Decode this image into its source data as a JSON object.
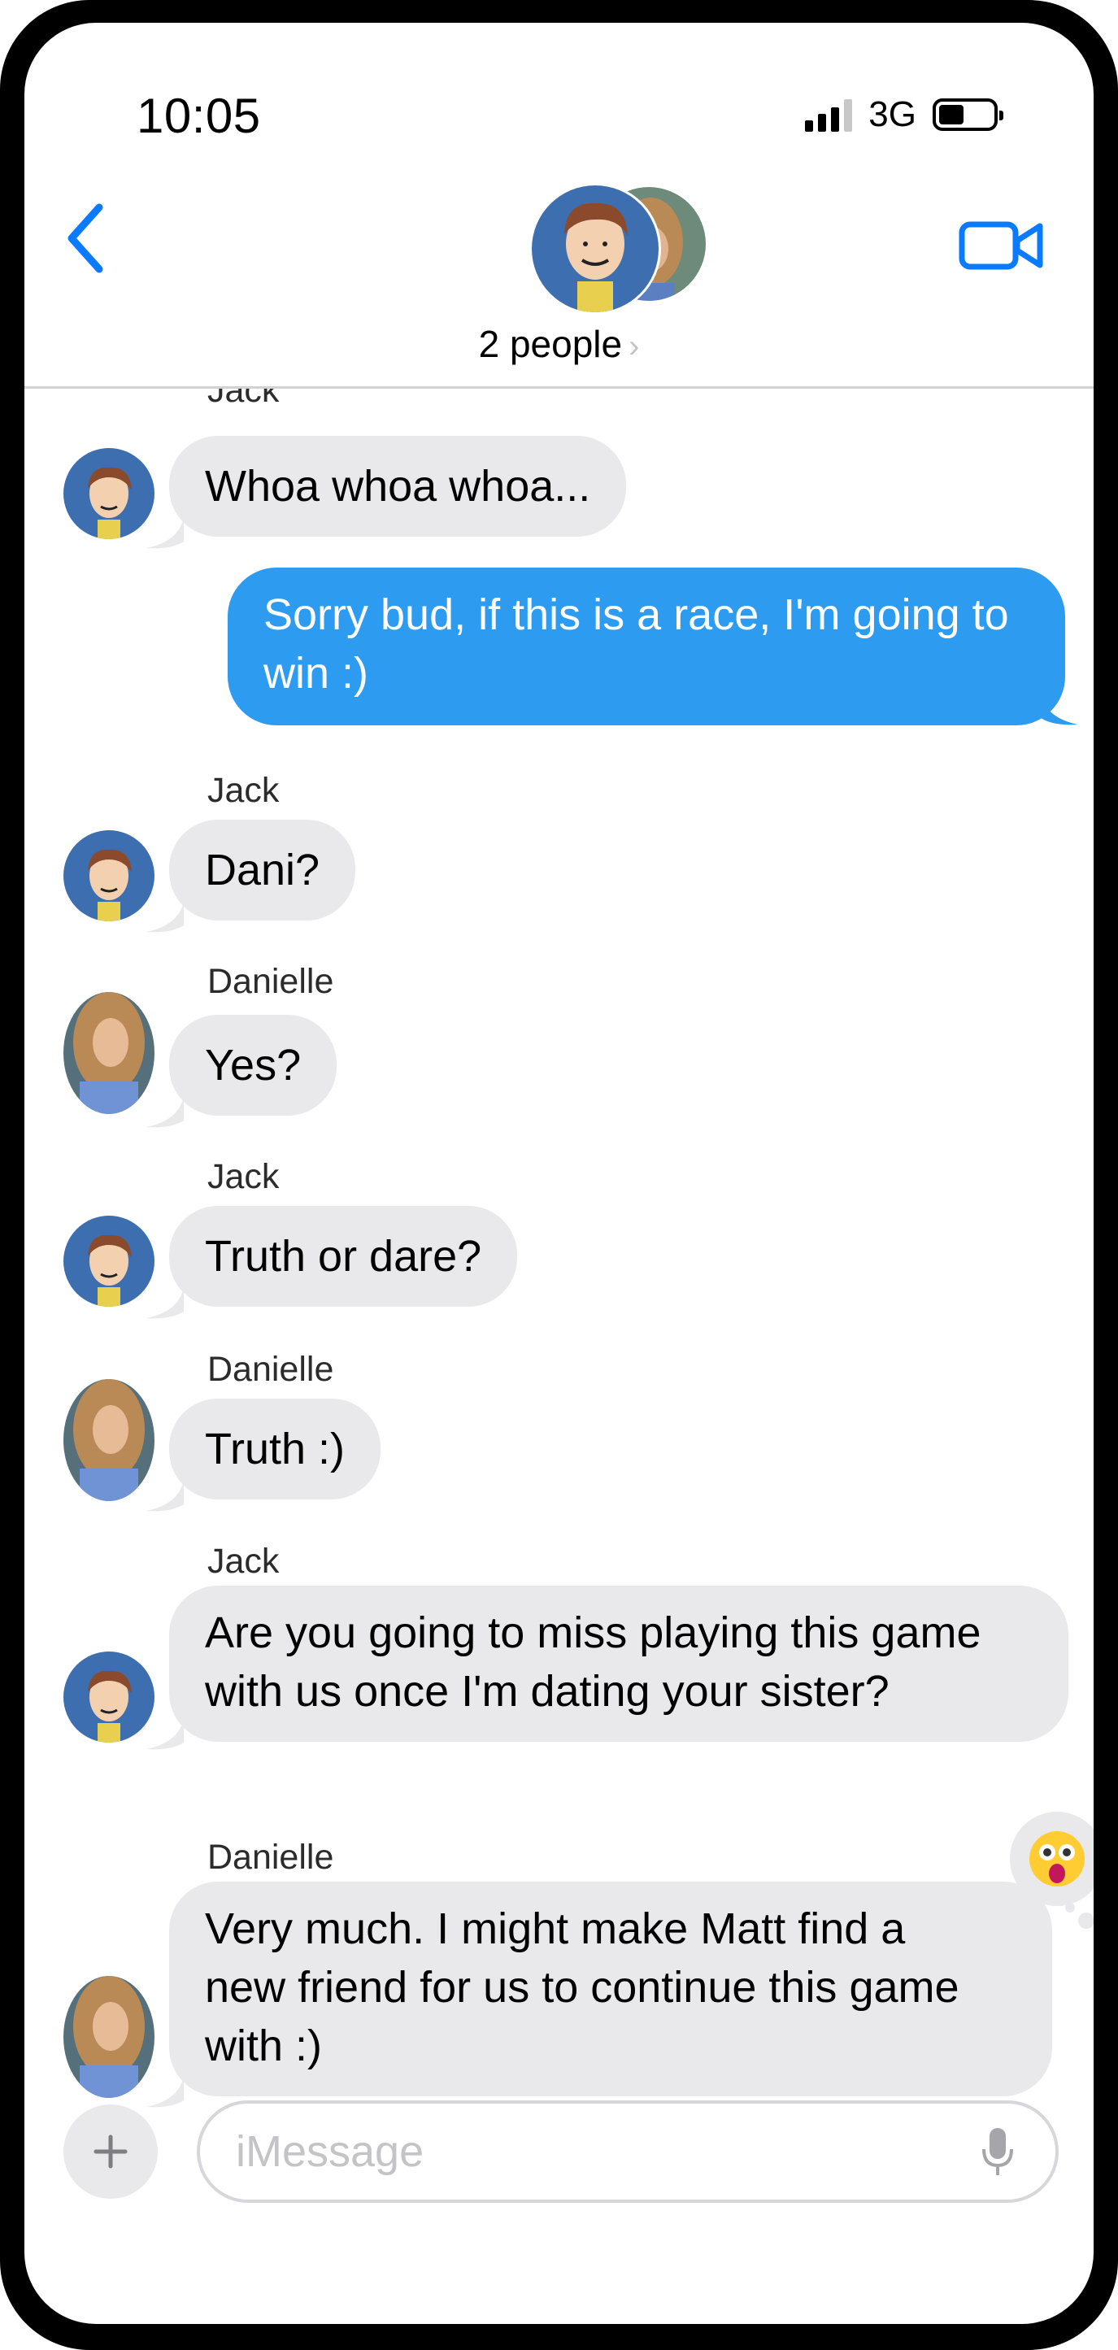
{
  "status_bar": {
    "time": "10:05",
    "network": "3G"
  },
  "header": {
    "title": "2 people",
    "chevron": "›"
  },
  "messages": [
    {
      "sender": "Jack",
      "text": "Whoa whoa whoa...",
      "direction": "incoming",
      "avatar": "jack-avatar"
    },
    {
      "sender": "",
      "text": "Sorry bud, if this is a race, I'm going to win :)",
      "line1": "Sorry bud, if this is a race, I'm going to",
      "line2": "win :)",
      "direction": "outgoing"
    },
    {
      "sender": "Jack",
      "text": "Dani?",
      "direction": "incoming",
      "avatar": "jack-avatar"
    },
    {
      "sender": "Danielle",
      "text": "Yes?",
      "direction": "incoming",
      "avatar": "danielle-avatar"
    },
    {
      "sender": "Jack",
      "text": "Truth or dare?",
      "direction": "incoming",
      "avatar": "jack-avatar"
    },
    {
      "sender": "Danielle",
      "text": "Truth :)",
      "direction": "incoming",
      "avatar": "danielle-avatar"
    },
    {
      "sender": "Jack",
      "line1": "Are you going to miss playing this game",
      "line2": "with us once I'm dating your sister?",
      "direction": "incoming",
      "avatar": "jack-avatar"
    },
    {
      "sender": "Danielle",
      "line1": "Very much.  I might make Matt find a",
      "line2": "new friend for us to continue this game",
      "line3": "with :)",
      "direction": "incoming",
      "avatar": "danielle-avatar",
      "reaction": "shocked-face-emoji"
    }
  ],
  "input": {
    "placeholder": "iMessage"
  },
  "colors": {
    "accent": "#0a7aff",
    "outgoing_bubble": "#2d9bf0",
    "incoming_bubble": "#e9e9eb"
  }
}
